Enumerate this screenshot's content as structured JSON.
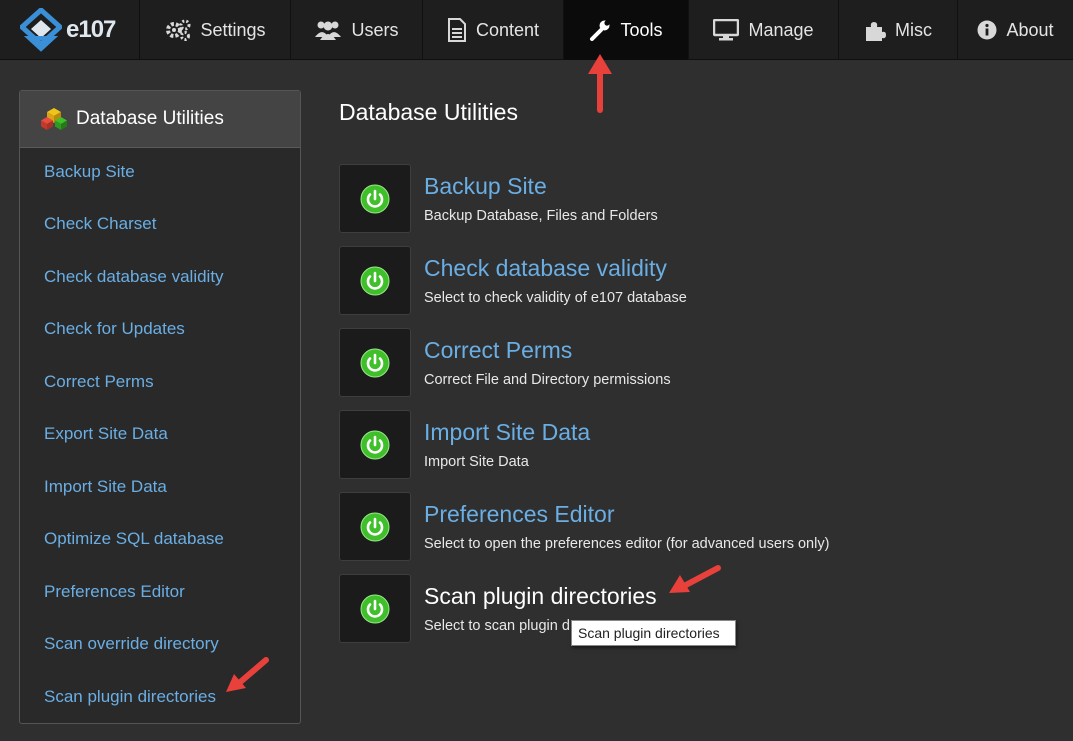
{
  "brand": {
    "logo_text": "e107"
  },
  "nav": {
    "settings": "Settings",
    "users": "Users",
    "content": "Content",
    "tools": "Tools",
    "manage": "Manage",
    "misc": "Misc",
    "about": "About"
  },
  "sidebar": {
    "title": "Database Utilities",
    "items": [
      "Backup Site",
      "Check Charset",
      "Check database validity",
      "Check for Updates",
      "Correct Perms",
      "Export Site Data",
      "Import Site Data",
      "Optimize SQL database",
      "Preferences Editor",
      "Scan override directory",
      "Scan plugin directories"
    ]
  },
  "main": {
    "title": "Database Utilities",
    "utilities": [
      {
        "title": "Backup Site",
        "desc": "Backup Database, Files and Folders"
      },
      {
        "title": "Check database validity",
        "desc": "Select to check validity of e107 database"
      },
      {
        "title": "Correct Perms",
        "desc": "Correct File and Directory permissions"
      },
      {
        "title": "Import Site Data",
        "desc": "Import Site Data"
      },
      {
        "title": "Preferences Editor",
        "desc": "Select to open the preferences editor (for advanced users only)"
      },
      {
        "title": "Scan plugin directories",
        "desc": "Select to scan plugin d"
      }
    ]
  },
  "tooltip": "Scan plugin directories",
  "colors": {
    "link": "#6aaee4",
    "annotation_arrow": "#e8403a",
    "power_green": "#3fbf2a"
  }
}
